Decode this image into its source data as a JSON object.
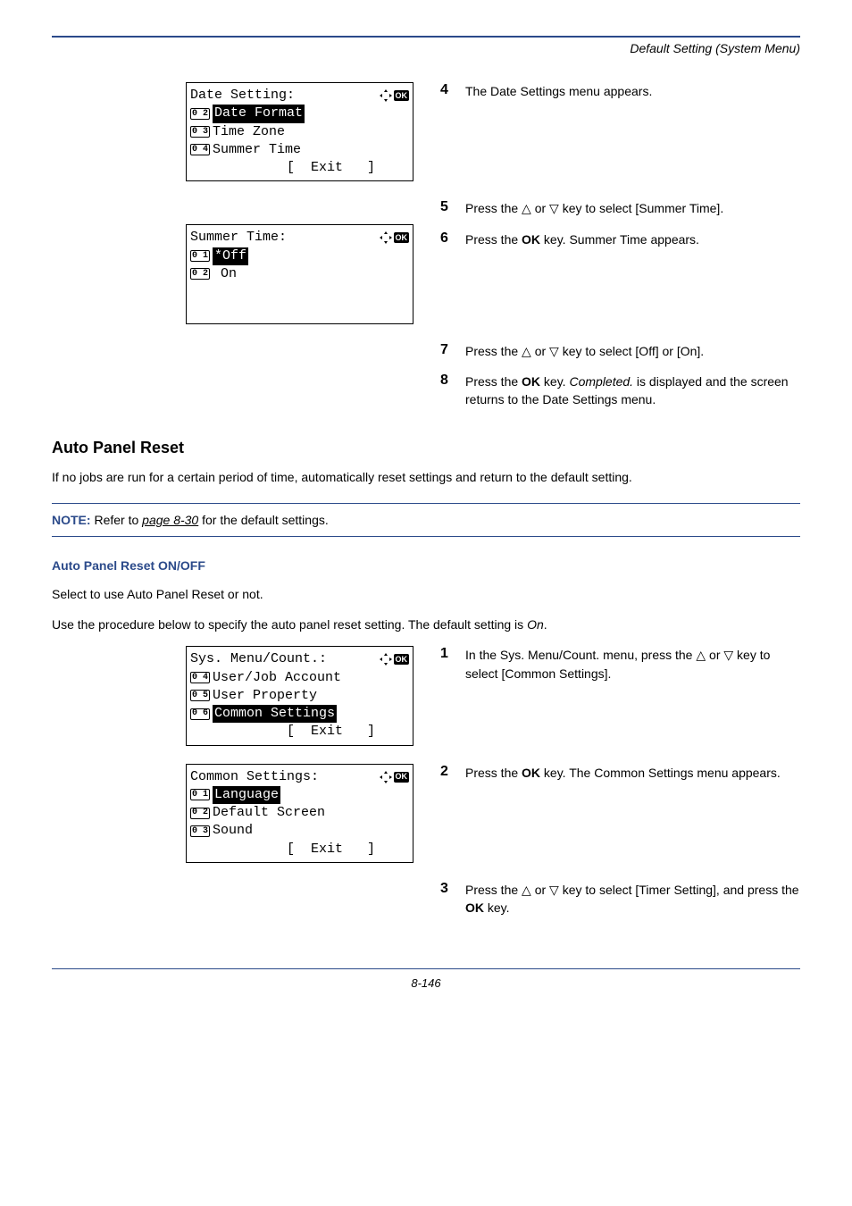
{
  "header": {
    "title": "Default Setting (System Menu)"
  },
  "lcd1": {
    "title": "Date Setting:",
    "items": [
      {
        "num": "0 2",
        "label": "Date Format",
        "hl": true
      },
      {
        "num": "0 3",
        "label": "Time Zone",
        "hl": false
      },
      {
        "num": "0 4",
        "label": "Summer Time",
        "hl": false
      }
    ],
    "exit": "[  Exit   ]"
  },
  "lcd2": {
    "title": "Summer Time:",
    "items": [
      {
        "num": "0 1",
        "label": "*Off",
        "hl": true
      },
      {
        "num": "0 2",
        "label": " On",
        "hl": false
      }
    ]
  },
  "lcd3": {
    "title": "Sys. Menu/Count.:",
    "items": [
      {
        "num": "0 4",
        "label": "User/Job Account",
        "hl": false
      },
      {
        "num": "0 5",
        "label": "User Property",
        "hl": false
      },
      {
        "num": "0 6",
        "label": "Common Settings",
        "hl": true
      }
    ],
    "exit": "[  Exit   ]"
  },
  "lcd4": {
    "title": "Common Settings:",
    "items": [
      {
        "num": "0 1",
        "label": "Language",
        "hl": true
      },
      {
        "num": "0 2",
        "label": "Default Screen",
        "hl": false
      },
      {
        "num": "0 3",
        "label": "Sound",
        "hl": false
      }
    ],
    "exit": "[  Exit   ]"
  },
  "steps_top": {
    "s4": "The Date Settings menu appears.",
    "s5_a": "Press the ",
    "s5_b": " or ",
    "s5_c": " key to select [Summer Time].",
    "s6_a": "Press the ",
    "s6_ok": "OK",
    "s6_b": " key. Summer Time appears.",
    "s7_a": "Press the ",
    "s7_b": " or ",
    "s7_c": " key to select [Off] or [On].",
    "s8_a": "Press the ",
    "s8_ok": "OK",
    "s8_b": " key. ",
    "s8_i": "Completed.",
    "s8_c": " is displayed and the screen returns to the Date Settings menu."
  },
  "section": {
    "title": "Auto Panel Reset",
    "intro": "If no jobs are run for a certain period of time, automatically reset settings and return to the default setting.",
    "note_label": "NOTE:",
    "note_a": " Refer to ",
    "note_link": "page 8-30",
    "note_b": " for the default settings.",
    "subhead": "Auto Panel Reset ON/OFF",
    "p1": "Select to use Auto Panel Reset or not.",
    "p2_a": "Use the procedure below to specify the auto panel reset setting. The default setting is ",
    "p2_i": "On",
    "p2_b": "."
  },
  "steps_bottom": {
    "s1_a": "In the Sys. Menu/Count. menu, press the ",
    "s1_b": " or ",
    "s1_c": " key to select [Common Settings].",
    "s2_a": "Press the ",
    "s2_ok": "OK",
    "s2_b": " key. The Common Settings menu appears.",
    "s3_a": "Press the ",
    "s3_b": " or ",
    "s3_c": " key to select [Timer Setting], and press the ",
    "s3_ok": "OK",
    "s3_d": " key."
  },
  "footer": {
    "page": "8-146"
  },
  "glyph": {
    "up": "△",
    "down": "▽",
    "ok": "OK"
  }
}
